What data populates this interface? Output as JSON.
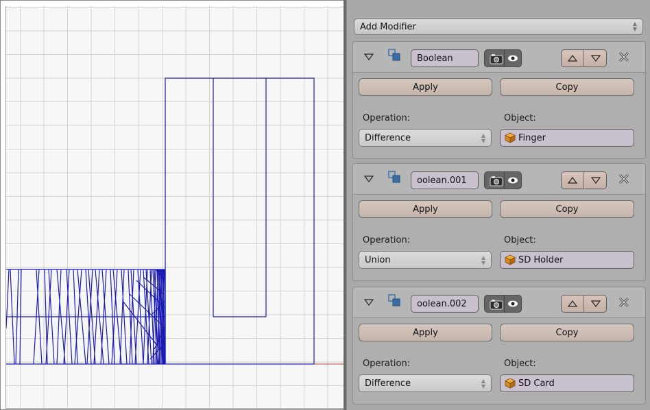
{
  "panel": {
    "add_modifier_label": "Add Modifier",
    "operation_label": "Operation:",
    "object_label": "Object:",
    "apply_label": "Apply",
    "copy_label": "Copy"
  },
  "modifiers": [
    {
      "name": "Boolean",
      "operation": "Difference",
      "object": "Finger"
    },
    {
      "name": "oolean.001",
      "operation": "Union",
      "object": "SD Holder"
    },
    {
      "name": "oolean.002",
      "operation": "Difference",
      "object": "SD Card"
    }
  ],
  "icons": {
    "collapse": "triangle-down-icon",
    "modifier": "boolean-modifier-icon",
    "render": "camera-icon",
    "viewport": "eye-icon",
    "move_up": "triangle-up-icon",
    "move_down": "triangle-down-icon",
    "remove": "x-close-icon",
    "object": "object-cube-icon"
  },
  "colors": {
    "wire": "#1a1ab4",
    "axis": "#c04040",
    "panel_bg": "#a9a9a9",
    "button": "#d0c0b8",
    "field": "#c9c1cd"
  }
}
